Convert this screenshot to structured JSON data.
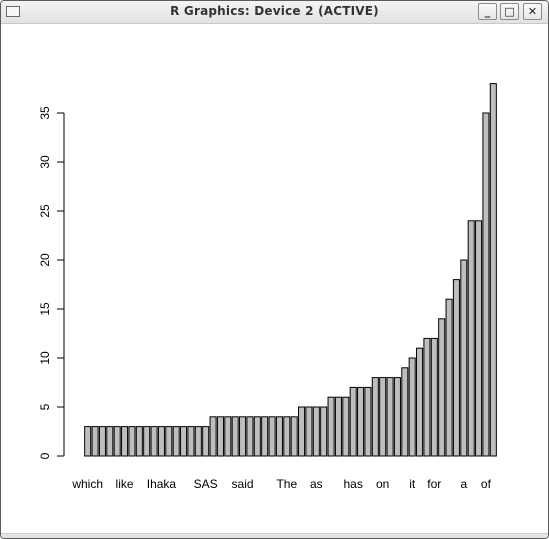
{
  "window": {
    "title": "R Graphics: Device 2 (ACTIVE)",
    "buttons": {
      "minimize": "_",
      "maximize": "□",
      "close": "✕"
    }
  },
  "chart_data": {
    "type": "bar",
    "title": "",
    "xlabel": "",
    "ylabel": "",
    "ylim": [
      0,
      38
    ],
    "yticks": [
      0,
      5,
      10,
      15,
      20,
      25,
      30,
      35
    ],
    "bar_fill": "#bebebe",
    "bar_stroke": "#000000",
    "values": [
      3,
      3,
      3,
      3,
      3,
      3,
      3,
      3,
      3,
      3,
      3,
      3,
      3,
      3,
      3,
      3,
      3,
      4,
      4,
      4,
      4,
      4,
      4,
      4,
      4,
      4,
      4,
      4,
      4,
      5,
      5,
      5,
      5,
      6,
      6,
      6,
      7,
      7,
      7,
      8,
      8,
      8,
      8,
      9,
      10,
      11,
      12,
      12,
      14,
      16,
      18,
      20,
      24,
      24,
      35,
      38
    ],
    "visible_x_labels": [
      {
        "bar_index": 0,
        "label": "which"
      },
      {
        "bar_index": 5,
        "label": "like"
      },
      {
        "bar_index": 10,
        "label": "Ihaka"
      },
      {
        "bar_index": 16,
        "label": "SAS"
      },
      {
        "bar_index": 21,
        "label": "said"
      },
      {
        "bar_index": 27,
        "label": "The"
      },
      {
        "bar_index": 31,
        "label": "as"
      },
      {
        "bar_index": 36,
        "label": "has"
      },
      {
        "bar_index": 40,
        "label": "on"
      },
      {
        "bar_index": 44,
        "label": "it"
      },
      {
        "bar_index": 47,
        "label": "for"
      },
      {
        "bar_index": 51,
        "label": "a"
      },
      {
        "bar_index": 54,
        "label": "of"
      }
    ]
  }
}
